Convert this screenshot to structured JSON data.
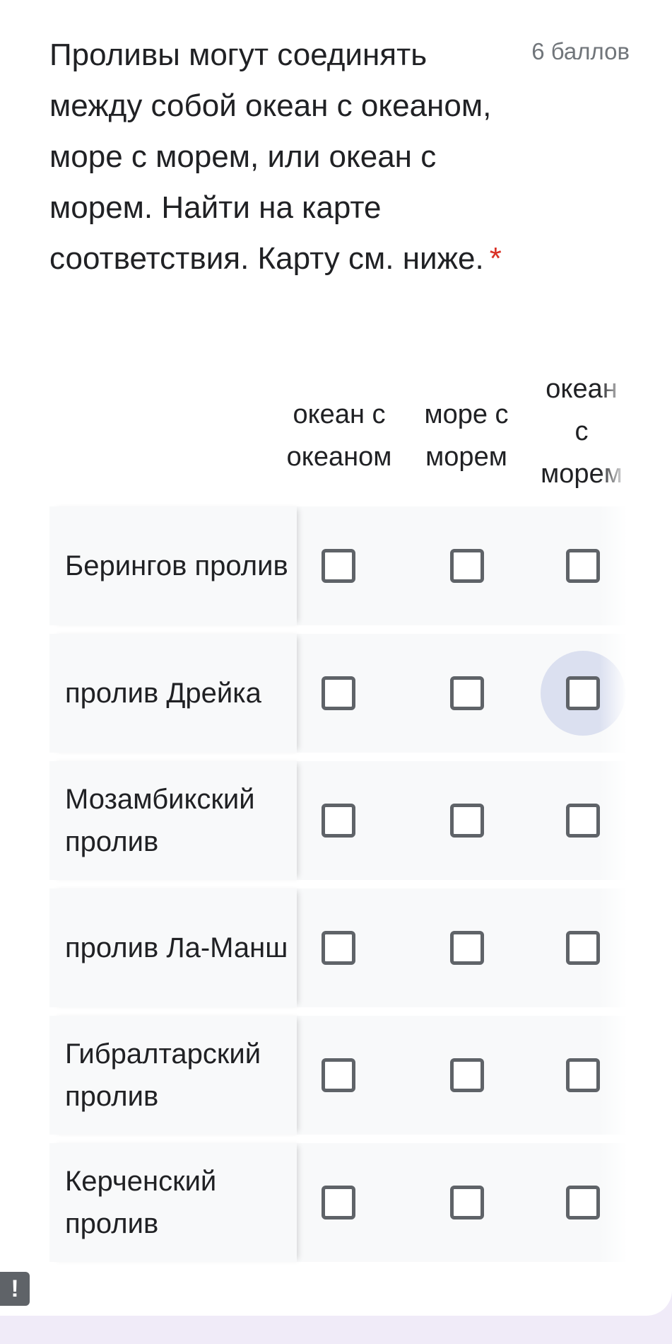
{
  "question": {
    "title": "Проливы могут соединять между собой океан с океаном, море с морем, или океан с морем. Найти на карте соответствия. Карту см. ниже.",
    "required_mark": "*",
    "points": "6 баллов"
  },
  "grid": {
    "columns": [
      {
        "label_line1": "океан с",
        "label_line2": "океаном"
      },
      {
        "label_line1": "море с",
        "label_line2": "морем"
      },
      {
        "label_line1": "океан",
        "label_line2": "с",
        "label_line3": "морем"
      }
    ],
    "rows": [
      {
        "label": "Берингов пролив",
        "checked": [
          false,
          false,
          false
        ]
      },
      {
        "label": "пролив Дрейка",
        "checked": [
          false,
          false,
          false
        ],
        "focused_column": 3
      },
      {
        "label": "Мозамбикский пролив",
        "checked": [
          false,
          false,
          false
        ]
      },
      {
        "label": "пролив Ла-Манш",
        "checked": [
          false,
          false,
          false
        ]
      },
      {
        "label": "Гибралтарский пролив",
        "checked": [
          false,
          false,
          false
        ]
      },
      {
        "label": "Керченский пролив",
        "checked": [
          false,
          false,
          false
        ]
      }
    ]
  },
  "report_button": {
    "icon": "exclamation-icon",
    "label": "!"
  },
  "colors": {
    "page_background": "#f0ebf8",
    "card_background": "#ffffff",
    "row_background": "#f8f9fa",
    "checkbox_border": "#5f6368",
    "required": "#d93025",
    "focus_halo": "#dde2f3"
  }
}
